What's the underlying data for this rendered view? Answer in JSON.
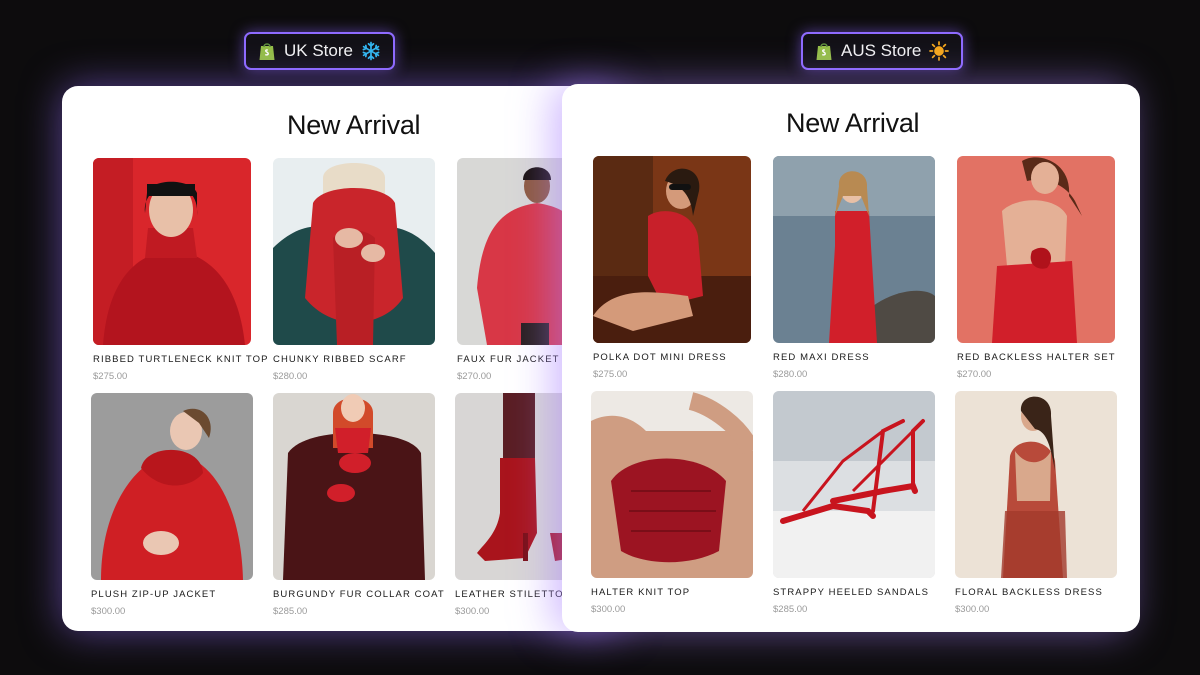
{
  "uk_store": {
    "badge_label": "UK Store",
    "title": "New Arrival",
    "products": [
      {
        "name": "RIBBED TURTLENECK KNIT TOP",
        "price": "$275.00"
      },
      {
        "name": "CHUNKY RIBBED SCARF",
        "price": "$280.00"
      },
      {
        "name": "FAUX FUR JACKET",
        "price": "$270.00"
      },
      {
        "name": "PLUSH ZIP-UP JACKET",
        "price": "$300.00"
      },
      {
        "name": "BURGUNDY FUR COLLAR COAT",
        "price": "$285.00"
      },
      {
        "name": "LEATHER STILETTO B",
        "price": "$300.00"
      }
    ]
  },
  "aus_store": {
    "badge_label": "AUS Store",
    "title": "New Arrival",
    "products": [
      {
        "name": "POLKA DOT MINI DRESS",
        "price": "$275.00"
      },
      {
        "name": "RED MAXI DRESS",
        "price": "$280.00"
      },
      {
        "name": "RED BACKLESS HALTER SET",
        "price": "$270.00"
      },
      {
        "name": "HALTER KNIT TOP",
        "price": "$300.00"
      },
      {
        "name": "STRAPPY HEELED SANDALS",
        "price": "$285.00"
      },
      {
        "name": "FLORAL BACKLESS DRESS",
        "price": "$300.00"
      }
    ]
  },
  "icons": {
    "shop": "shopify-bag-icon",
    "uk_symbol": "snowflake-icon",
    "aus_symbol": "sun-icon"
  },
  "colors": {
    "background": "#0d0c0d",
    "badge_border": "#8e6bff",
    "glow": "#9a72ff",
    "shopify_green": "#95bf47",
    "snowflake_blue": "#33b8f0",
    "sun_orange": "#f7a81b",
    "accent_red": "#d11f2a"
  }
}
